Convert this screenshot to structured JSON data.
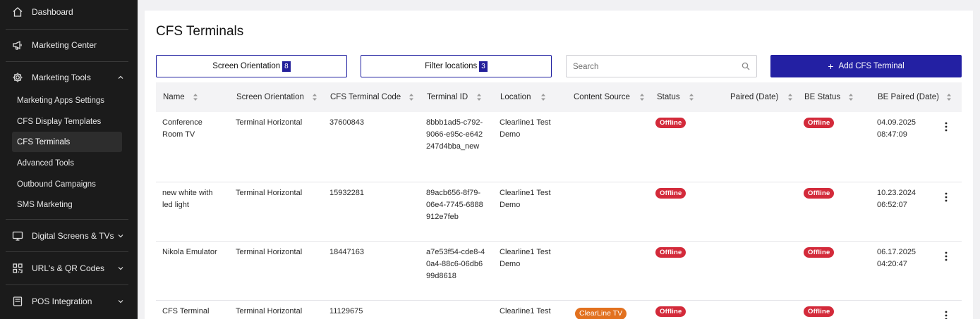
{
  "sidebar": {
    "dashboard": "Dashboard",
    "marketing_center": "Marketing Center",
    "marketing_tools": "Marketing Tools",
    "sub_items": [
      "Marketing Apps Settings",
      "CFS Display Templates",
      "CFS Terminals",
      "Advanced Tools",
      "Outbound Campaigns",
      "SMS Marketing"
    ],
    "digital_screens": "Digital Screens & TVs",
    "url_qr": "URL's & QR Codes",
    "pos_integration": "POS Integration"
  },
  "page": {
    "title": "CFS Terminals"
  },
  "toolbar": {
    "screen_orientation_label": "Screen Orientation",
    "screen_orientation_count": "8",
    "filter_locations_label": "Filter locations",
    "filter_locations_count": "3",
    "search_placeholder": "Search",
    "add_label": "Add CFS Terminal"
  },
  "table": {
    "columns": [
      "Name",
      "Screen Orientation",
      "CFS Terminal Code",
      "Terminal ID",
      "Location",
      "Content Source",
      "Status",
      "Paired (Date)",
      "BE Status",
      "BE Paired (Date)"
    ],
    "rows": [
      {
        "name": "Conference Room TV",
        "orientation": "Terminal Horizontal",
        "code": "37600843",
        "terminal_id": "8bbb1ad5-c792-9066-e95c-e642247d4bba_new",
        "location": "Clearline1 Test Demo",
        "content_source": "",
        "status": "Offline",
        "paired": "",
        "be_status": "Offline",
        "be_paired": "04.09.2025 08:47:09"
      },
      {
        "name": "new white with led light",
        "orientation": "Terminal Horizontal",
        "code": "15932281",
        "terminal_id": "89acb656-8f79-06e4-7745-6888912e7feb",
        "location": "Clearline1 Test Demo",
        "content_source": "",
        "status": "Offline",
        "paired": "",
        "be_status": "Offline",
        "be_paired": "10.23.2024 06:52:07"
      },
      {
        "name": "Nikola Emulator",
        "orientation": "Terminal Horizontal",
        "code": "18447163",
        "terminal_id": "a7e53f54-cde8-40a4-88c6-06db699d8618",
        "location": "Clearline1 Test Demo",
        "content_source": "",
        "status": "Offline",
        "paired": "",
        "be_status": "Offline",
        "be_paired": "06.17.2025 04:20:47"
      },
      {
        "name": "CFS Terminal",
        "orientation": "Terminal Horizontal",
        "code": "11129675",
        "terminal_id": "",
        "location": "Clearline1 Test",
        "content_source": "ClearLine TV",
        "status": "Offline",
        "paired": "",
        "be_status": "Offline",
        "be_paired": ""
      }
    ]
  },
  "colors": {
    "accent": "#2320a3",
    "offline": "#d32a3a",
    "source_badge": "#e2711f",
    "sidebar_bg": "#1b1b1b"
  }
}
